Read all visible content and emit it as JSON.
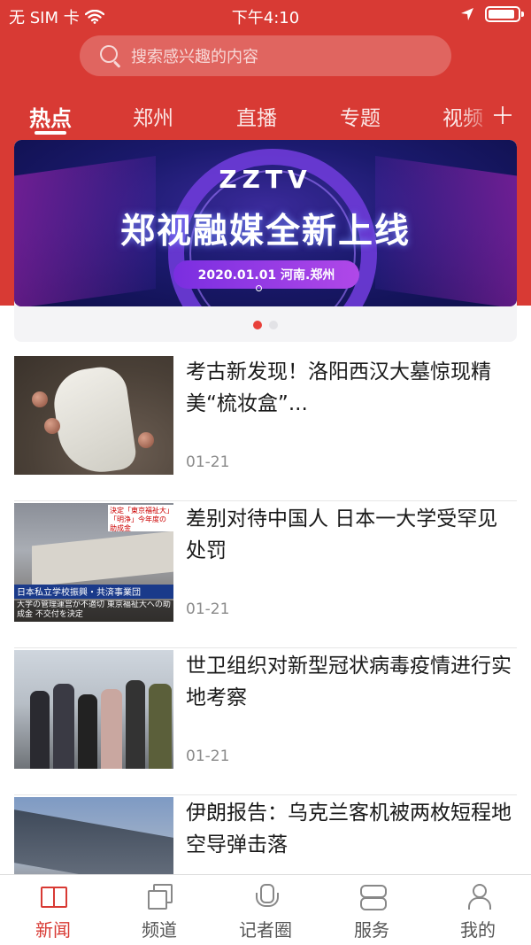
{
  "status_bar": {
    "carrier": "无 SIM 卡",
    "time": "下午4:10"
  },
  "search": {
    "placeholder": "搜索感兴趣的内容"
  },
  "tabs": [
    {
      "label": "热点",
      "active": true
    },
    {
      "label": "郑州",
      "active": false
    },
    {
      "label": "直播",
      "active": false
    },
    {
      "label": "专题",
      "active": false
    },
    {
      "label": "视频",
      "active": false
    }
  ],
  "banner": {
    "logo": "ZZTV",
    "title": "郑视融媒全新上线",
    "subtitle": "2020.01.01  河南.郑州",
    "page_count": 2,
    "current_page": 1
  },
  "news": [
    {
      "title": "考古新发现！洛阳西汉大墓惊现精美“梳妆盒”...",
      "date": "01-21"
    },
    {
      "title": "差别对待中国人 日本一大学受罕见处罚",
      "date": "01-21",
      "thumb_text": {
        "tag": "決定「東京福祉大」「明浄」今年度の助成金",
        "caption1": "日本私立学校振興・共済事業団",
        "caption2": "大学の管理運営が不適切 東京福祉大への助成金 不交付を決定"
      }
    },
    {
      "title": "世卫组织对新型冠状病毒疫情进行实地考察",
      "date": "01-21"
    },
    {
      "title": "伊朗报告：乌克兰客机被两枚短程地空导弹击落",
      "date": ""
    }
  ],
  "tabbar": [
    {
      "label": "新闻",
      "icon": "book-icon",
      "active": true
    },
    {
      "label": "频道",
      "icon": "squares-icon",
      "active": false
    },
    {
      "label": "记者圈",
      "icon": "mic-icon",
      "active": false
    },
    {
      "label": "服务",
      "icon": "pills-icon",
      "active": false
    },
    {
      "label": "我的",
      "icon": "user-icon",
      "active": false
    }
  ],
  "colors": {
    "brand_red": "#d83a34",
    "active_dot": "#e8403a"
  }
}
